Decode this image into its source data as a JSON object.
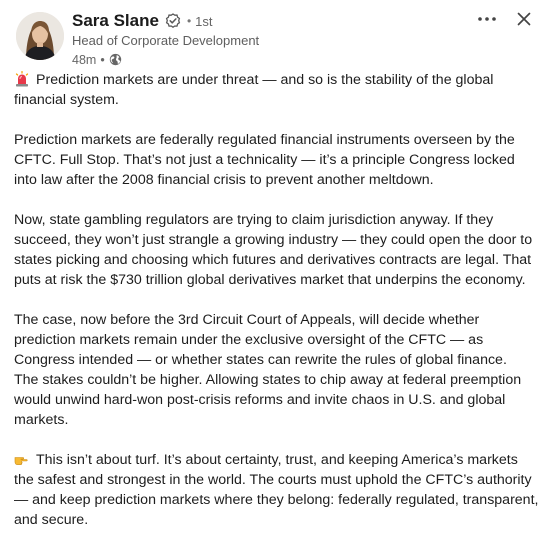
{
  "author": {
    "name": "Sara Slane",
    "degree": "1st",
    "headline": "Head of Corporate Development",
    "posted": "48m",
    "visibility_icon": "globe-icon",
    "verified_icon": "verified-badge-icon"
  },
  "controls": {
    "more_label": "···",
    "close_label": "✕"
  },
  "post": {
    "p1_emoji": "rotating-light-icon",
    "p1": "Prediction markets are under threat — and so is the stability of the global financial system.",
    "p2": "Prediction markets are federally regulated financial instruments overseen by the CFTC. Full Stop. That’s not just a technicality — it’s a principle Congress locked into law after the 2008 financial crisis to prevent another meltdown.",
    "p3": "Now, state gambling regulators are trying to claim jurisdiction anyway. If they succeed, they won’t just strangle a growing industry — they could open the door to states picking and choosing which futures and derivatives contracts are legal. That puts at risk the $730 trillion global derivatives market that underpins the economy.",
    "p4": "The case, now before the 3rd Circuit Court of Appeals, will decide whether prediction markets remain under the exclusive oversight of the CFTC — as Congress intended — or whether states can rewrite the rules of global finance.",
    "p5": "The stakes couldn’t be higher. Allowing states to chip away at federal preemption would unwind hard-won post-crisis reforms and invite chaos in U.S. and global markets.",
    "p6_emoji": "pointing-hand-icon",
    "p6": "This isn’t about turf. It’s about certainty, trust, and keeping America’s markets the safest and strongest in the world. The courts must uphold the CFTC’s authority — and keep prediction markets where they belong: federally regulated, transparent, and secure."
  }
}
